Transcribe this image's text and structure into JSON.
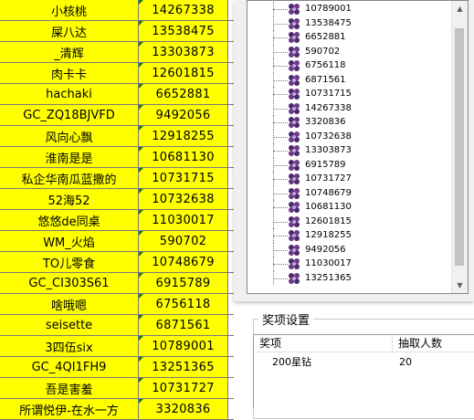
{
  "sheet": {
    "rows": [
      {
        "name": "小核桃",
        "id": "14267338"
      },
      {
        "name": "屎八达",
        "id": "13538475"
      },
      {
        "name": "_清辉",
        "id": "13303873"
      },
      {
        "name": "肉卡卡",
        "id": "12601815"
      },
      {
        "name": "hachaki",
        "id": "6652881"
      },
      {
        "name": "GC_ZQ18BJVFD",
        "id": "9492056"
      },
      {
        "name": "风向心飘",
        "id": "12918255"
      },
      {
        "name": "淮南是是",
        "id": "10681130"
      },
      {
        "name": "私企华南瓜蓝撒的",
        "id": "10731715"
      },
      {
        "name": "52海52",
        "id": "10732638"
      },
      {
        "name": "悠悠de同桌",
        "id": "11030017"
      },
      {
        "name": "WM_火焰",
        "id": "590702"
      },
      {
        "name": "TO儿零食",
        "id": "10748679"
      },
      {
        "name": "GC_CI303S61",
        "id": "6915789"
      },
      {
        "name": "啥哦嗯",
        "id": "6756118"
      },
      {
        "name": "seisette",
        "id": "6871561"
      },
      {
        "name": "3四伍six",
        "id": "10789001"
      },
      {
        "name": "GC_4QI1FH9",
        "id": "13251365"
      },
      {
        "name": "吾是害羞",
        "id": "10731727"
      },
      {
        "name": "所谓悦伊-在水一方",
        "id": "3320836"
      }
    ],
    "color": "#ffff00"
  },
  "listbox": {
    "items": [
      "10789001",
      "13538475",
      "6652881",
      "590702",
      "6756118",
      "6871561",
      "10731715",
      "14267338",
      "3320836",
      "10732638",
      "13303873",
      "6915789",
      "10731727",
      "10748679",
      "10681130",
      "12601815",
      "12918255",
      "9492056",
      "11030017",
      "13251365"
    ],
    "scroll_up_icon": "arrow-up-icon",
    "scroll_down_icon": "arrow-down-icon"
  },
  "prize": {
    "title": "奖项设置",
    "headers": [
      "奖项",
      "抽取人数"
    ],
    "rows": [
      {
        "item": "200星钻",
        "count": "20"
      }
    ]
  }
}
